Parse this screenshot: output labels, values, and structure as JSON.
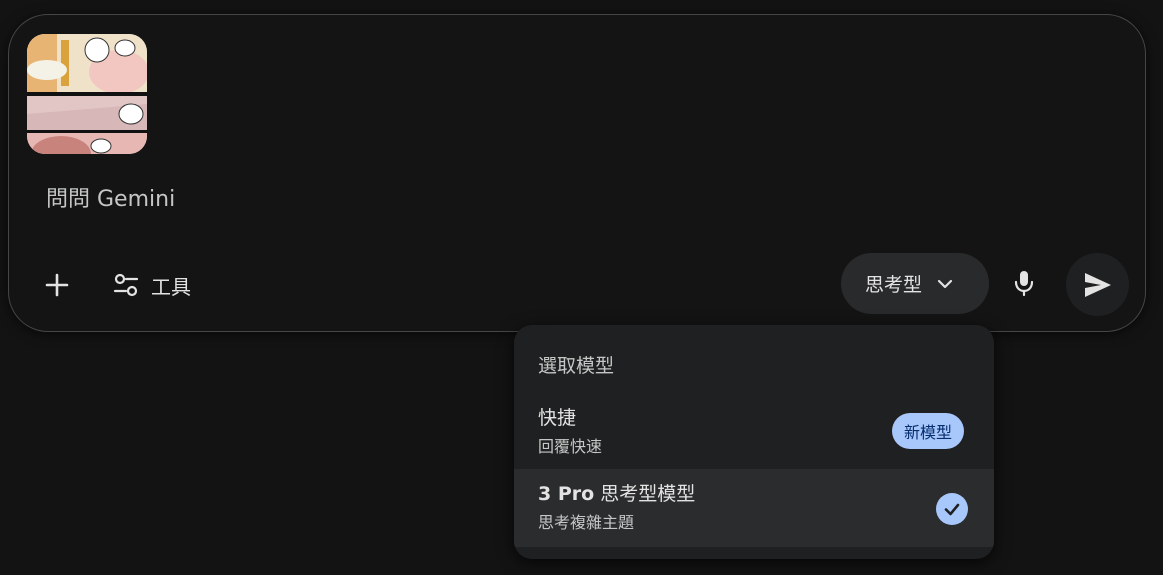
{
  "composer": {
    "placeholder": "問問 Gemini",
    "tools_label": "工具",
    "model_selector_label": "思考型"
  },
  "model_menu": {
    "title": "選取模型",
    "items": [
      {
        "title": "快捷",
        "subtitle": "回覆快速",
        "badge": "新模型",
        "selected": false
      },
      {
        "title_prefix": "3 Pro",
        "title": "思考型模型",
        "subtitle": "思考複雜主題",
        "selected": true
      }
    ]
  },
  "icons": {
    "attachment": "image-thumbnail",
    "add": "plus-icon",
    "tools": "tune-icon",
    "model_dropdown": "chevron-down-icon",
    "mic": "mic-icon",
    "send": "send-icon",
    "selected": "check-circle-icon"
  },
  "colors": {
    "background": "#131313",
    "accent": "#a8c7fa",
    "menu_bg": "#1f2021",
    "selected_row": "#2a2c2e"
  }
}
